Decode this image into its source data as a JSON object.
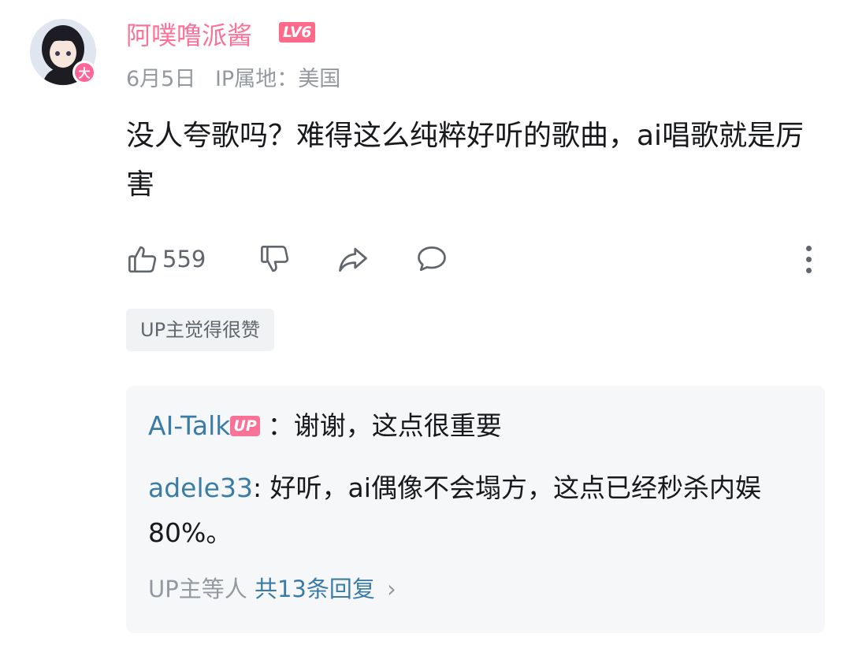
{
  "comment": {
    "username": "阿噗噜派酱",
    "level": "LV6",
    "avatar_badge": "大",
    "date": "6月5日",
    "ip_location": "IP属地：美国",
    "text": "没人夸歌吗？难得这么纯粹好听的歌曲，ai唱歌就是厉害",
    "like_count": "559",
    "up_liked_label": "UP主觉得很赞",
    "colors": {
      "username": "#fb7299",
      "reply_name": "#3b7ca7",
      "meta": "#9499a0"
    }
  },
  "replies": [
    {
      "name": "AI-Talk",
      "badge": "UP",
      "separator": "：",
      "text": "谢谢，这点很重要"
    },
    {
      "name": "adele33",
      "separator": ": ",
      "text": "好听，ai偶像不会塌方，这点已经秒杀内娱 80%。"
    }
  ],
  "more_replies": {
    "prefix": "UP主等人",
    "total": "共13条回复",
    "chevron": "›"
  },
  "icons": [
    "like-icon",
    "dislike-icon",
    "share-icon",
    "comment-icon",
    "more-vertical-icon",
    "chevron-right-icon"
  ]
}
